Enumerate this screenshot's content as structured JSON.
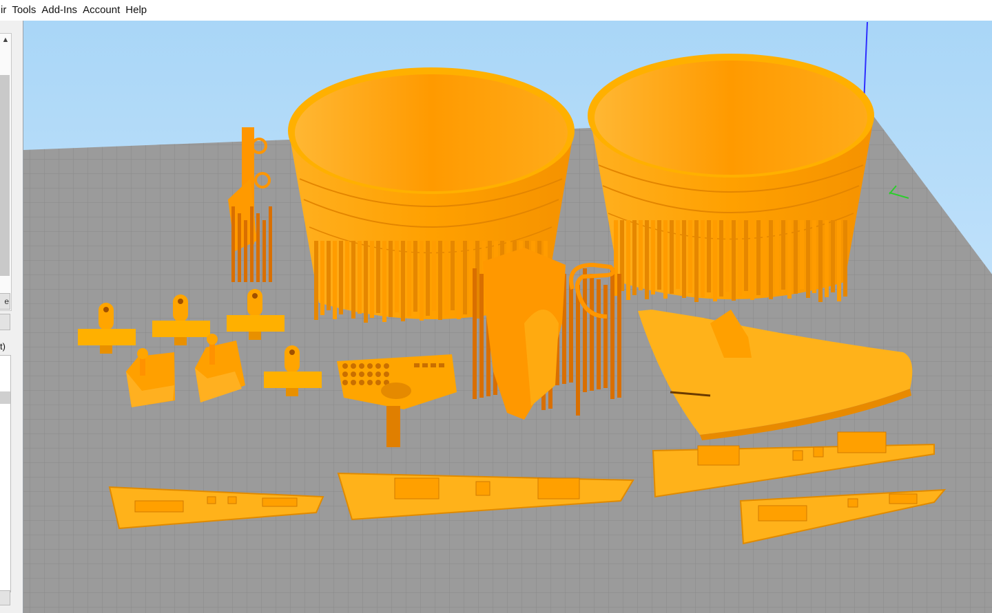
{
  "menu": {
    "items": [
      {
        "label": "ir",
        "name": "menu-repair"
      },
      {
        "label": "Tools",
        "name": "menu-tools"
      },
      {
        "label": "Add-Ins",
        "name": "menu-add-ins"
      },
      {
        "label": "Account",
        "name": "menu-account"
      },
      {
        "label": "Help",
        "name": "menu-help"
      }
    ]
  },
  "left_panel": {
    "scroll_up": "▲",
    "scroll_down": "▼",
    "button_a": "e",
    "button_b": "",
    "list_label": "t)"
  },
  "viewport": {
    "background_top": "#a9d6f7",
    "background_bottom": "#dcefff",
    "bed_color": "#9b9b9b",
    "grid_color": "#8a8a8a",
    "model_color": "#ffa500",
    "model_shadow": "#e07c00",
    "support_color": "#d96f00",
    "axis_z_color": "#2d2dff",
    "axis_y_color": "#2dcc2d"
  }
}
